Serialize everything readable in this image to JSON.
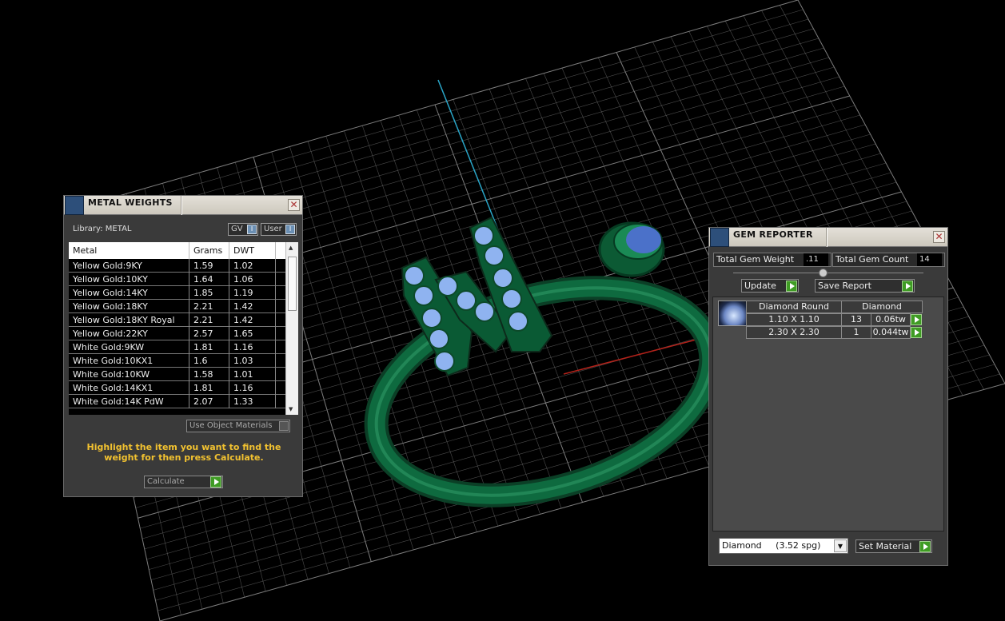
{
  "viewport": {
    "grid_color": "#8a8a8a",
    "ring_color": "#0d5a36",
    "gem_color": "#8fb3f0"
  },
  "metal_weights": {
    "title": "METAL WEIGHTS",
    "library_label": "Library: METAL",
    "toggle_gv": "GV",
    "toggle_user": "User",
    "columns": [
      "Metal",
      "Grams",
      "DWT"
    ],
    "rows": [
      [
        "Yellow Gold:9KY",
        "1.59",
        "1.02"
      ],
      [
        "Yellow Gold:10KY",
        "1.64",
        "1.06"
      ],
      [
        "Yellow Gold:14KY",
        "1.85",
        "1.19"
      ],
      [
        "Yellow Gold:18KY",
        "2.21",
        "1.42"
      ],
      [
        "Yellow Gold:18KY Royal",
        "2.21",
        "1.42"
      ],
      [
        "Yellow Gold:22KY",
        "2.57",
        "1.65"
      ],
      [
        "White Gold:9KW",
        "1.81",
        "1.16"
      ],
      [
        "White Gold:10KX1",
        "1.6",
        "1.03"
      ],
      [
        "White Gold:10KW",
        "1.58",
        "1.01"
      ],
      [
        "White Gold:14KX1",
        "1.81",
        "1.16"
      ],
      [
        "White Gold:14K PdW",
        "2.07",
        "1.33"
      ]
    ],
    "use_object_materials": "Use Object Materials",
    "hint": "Highlight the item you want to find the weight for then press Calculate.",
    "calculate_label": "Calculate"
  },
  "gem_reporter": {
    "title": "GEM REPORTER",
    "total_gem_weight_label": "Total Gem Weight",
    "total_gem_weight_value": ".11",
    "total_gem_count_label": "Total Gem Count",
    "total_gem_count_value": "14",
    "update_label": "Update",
    "save_report_label": "Save Report",
    "gem_header": [
      "Diamond Round",
      "Diamond"
    ],
    "gem_rows": [
      [
        "1.10 X 1.10",
        "13",
        "0.06tw"
      ],
      [
        "2.30 X 2.30",
        "1",
        "0.044tw"
      ]
    ],
    "material_select": "Diamond     (3.52 spg)",
    "set_material_label": "Set Material"
  }
}
